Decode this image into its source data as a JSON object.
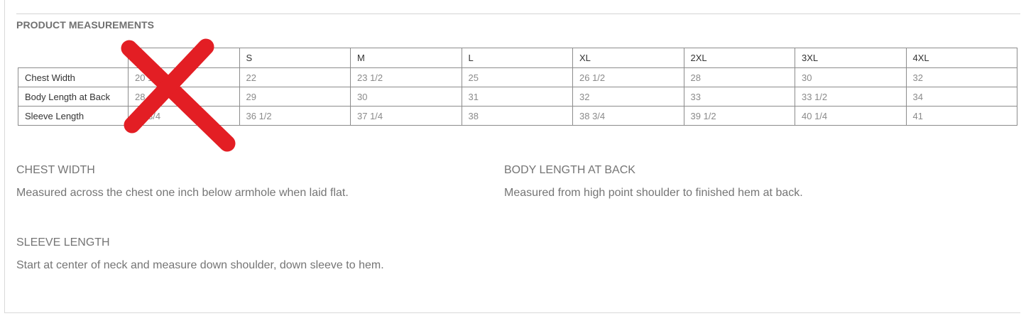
{
  "section_title": "PRODUCT MEASUREMENTS",
  "table": {
    "corner": "",
    "sizes": [
      "",
      "S",
      "M",
      "L",
      "XL",
      "2XL",
      "3XL",
      "4XL"
    ],
    "rows": [
      {
        "label": "Chest Width",
        "values": [
          "20 1/2",
          "22",
          "23 1/2",
          "25",
          "26 1/2",
          "28",
          "30",
          "32"
        ]
      },
      {
        "label": "Body Length at Back",
        "values": [
          "28",
          "29",
          "30",
          "31",
          "32",
          "33",
          "33 1/2",
          "34"
        ]
      },
      {
        "label": "Sleeve Length",
        "values": [
          "35 3/4",
          "36 1/2",
          "37 1/4",
          "38",
          "38 3/4",
          "39 1/2",
          "40 1/4",
          "41"
        ]
      }
    ]
  },
  "descriptions": {
    "chest": {
      "title": "CHEST WIDTH",
      "text": "Measured across the chest one inch below armhole when laid flat."
    },
    "body": {
      "title": "BODY LENGTH AT BACK",
      "text": "Measured from high point shoulder to finished hem at back."
    },
    "sleeve": {
      "title": "SLEEVE LENGTH",
      "text": "Start at center of neck and measure down shoulder, down sleeve to hem."
    }
  },
  "overlay": {
    "icon": "red-x-mark-icon",
    "color": "#e31e24"
  }
}
